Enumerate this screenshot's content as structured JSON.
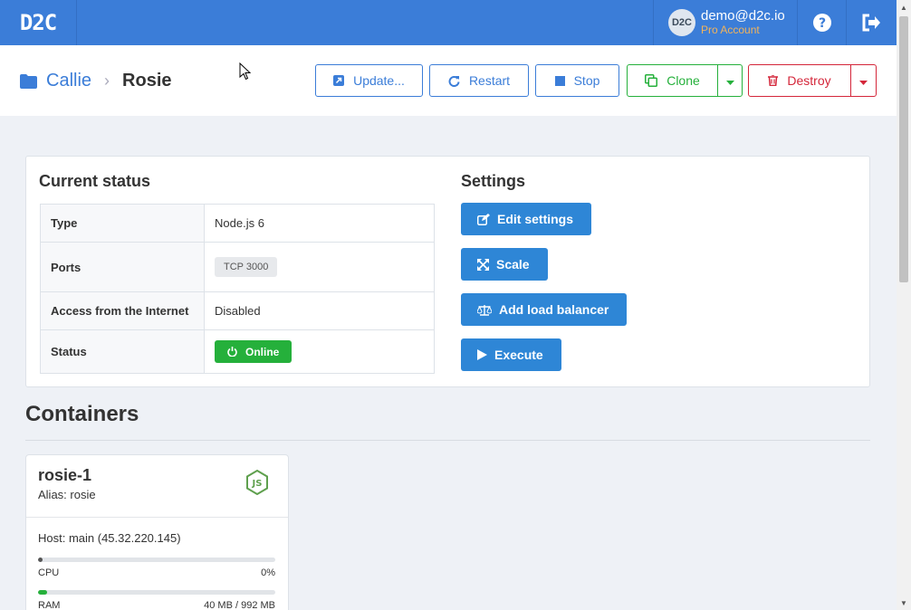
{
  "brand": {
    "logo": "D2C"
  },
  "user": {
    "avatar": "D2C",
    "email": "demo@d2c.io",
    "plan": "Pro Account"
  },
  "breadcrumb": {
    "parent": "Callie",
    "separator": "›",
    "current": "Rosie"
  },
  "actions": {
    "update": "Update...",
    "restart": "Restart",
    "stop": "Stop",
    "clone": "Clone",
    "destroy": "Destroy"
  },
  "status_panel": {
    "title": "Current status",
    "rows": [
      {
        "key": "Type",
        "value": "Node.js 6"
      },
      {
        "key": "Ports",
        "value": "TCP 3000"
      },
      {
        "key": "Access from the Internet",
        "value": "Disabled"
      },
      {
        "key": "Status",
        "value": "Online"
      }
    ]
  },
  "settings_panel": {
    "title": "Settings",
    "buttons": {
      "edit": "Edit settings",
      "scale": "Scale",
      "load_balancer": "Add load balancer",
      "execute": "Execute"
    }
  },
  "containers": {
    "title": "Containers",
    "items": [
      {
        "name": "rosie-1",
        "alias": "Alias: rosie",
        "host": "Host: main (45.32.220.145)",
        "cpu_label": "CPU",
        "cpu_value": "0%",
        "cpu_fraction": 0.02,
        "ram_label": "RAM",
        "ram_value": "40 MB / 992 MB",
        "ram_fraction": 0.04
      }
    ]
  },
  "colors": {
    "primary": "#3b7dd8",
    "success": "#25b03b",
    "danger": "#d4263a",
    "accent": "#f2b35a"
  }
}
